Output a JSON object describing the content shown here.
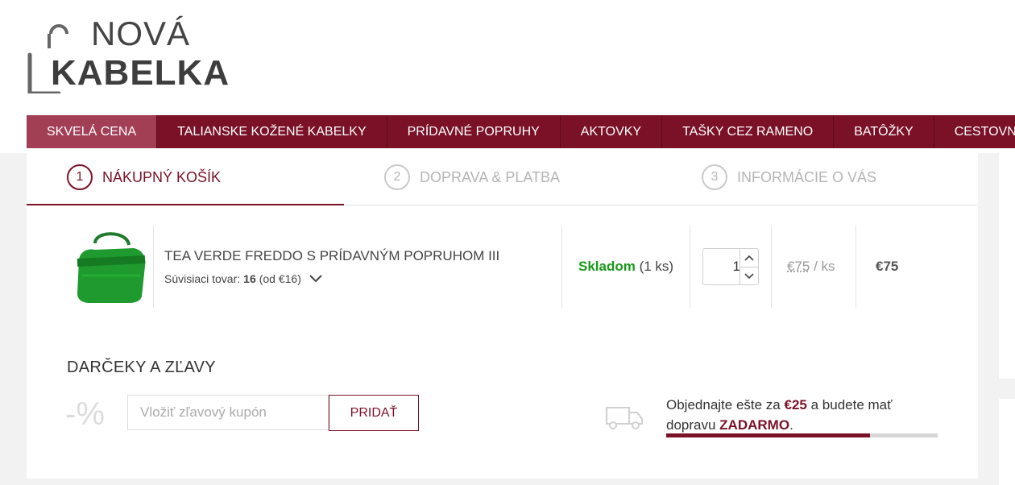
{
  "brand": {
    "line1": "NOVÁ",
    "line2": "KABELKA"
  },
  "nav": [
    {
      "label": "SKVELÁ CENA",
      "active": true
    },
    {
      "label": "TALIANSKE KOŽENÉ KABELKY"
    },
    {
      "label": "PRÍDAVNÉ POPRUHY"
    },
    {
      "label": "AKTOVKY"
    },
    {
      "label": "TAŠKY CEZ RAMENO"
    },
    {
      "label": "BATÔŽKY"
    },
    {
      "label": "CESTOVNÉ TAŠKY"
    }
  ],
  "steps": [
    {
      "num": "1",
      "label": "NÁKUPNÝ KOŠÍK"
    },
    {
      "num": "2",
      "label": "DOPRAVA & PLATBA"
    },
    {
      "num": "3",
      "label": "INFORMÁCIE O VÁS"
    }
  ],
  "product": {
    "name": "TEA VERDE FREDDO S PRÍDAVNÝM POPRUHOM III",
    "related_label": "Súvisiaci tovar:",
    "related_count": "16",
    "related_from": "(od €16)",
    "stock_status": "Skladom",
    "stock_qty": "(1 ks)",
    "quantity": "1",
    "unit_price": "€75",
    "unit_suffix": "/ ks",
    "total": "€75"
  },
  "gifts": {
    "title": "DARČEKY A ZĽAVY",
    "percent_icon": "-%",
    "coupon_placeholder": "Vložiť zľavový kupón",
    "add_label": "PRIDAŤ"
  },
  "shipping": {
    "text_before": "Objednajte ešte za",
    "amount": "€25",
    "text_middle": "a budete mať dopravu",
    "free": "ZADARMO",
    "text_end": ".",
    "progress": 0.75
  },
  "colors": {
    "accent": "#7a1126",
    "stock": "#1a9a1a"
  }
}
